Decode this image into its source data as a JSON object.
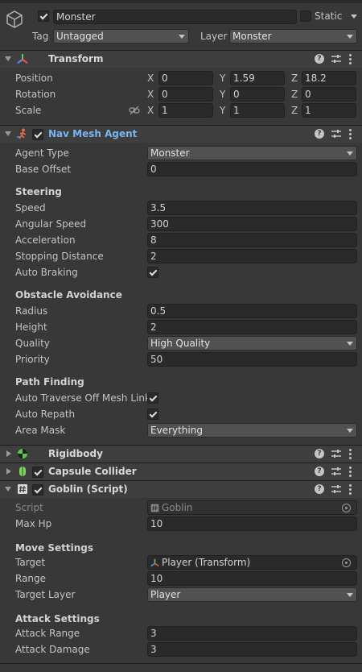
{
  "object": {
    "active": true,
    "name": "Monster",
    "static_label": "Static",
    "static_checked": false,
    "tag_label": "Tag",
    "tag_value": "Untagged",
    "layer_label": "Layer",
    "layer_value": "Monster"
  },
  "transform": {
    "title": "Transform",
    "rows": [
      {
        "label": "Position",
        "x": "0",
        "y": "1.59",
        "z": "18.2"
      },
      {
        "label": "Rotation",
        "x": "0",
        "y": "0",
        "z": "0"
      },
      {
        "label": "Scale",
        "x": "1",
        "y": "1",
        "z": "1"
      }
    ],
    "axis": {
      "x": "X",
      "y": "Y",
      "z": "Z"
    }
  },
  "nav": {
    "title": "Nav Mesh Agent",
    "enabled": true,
    "agent_type_label": "Agent Type",
    "agent_type": "Monster",
    "base_offset_label": "Base Offset",
    "base_offset": "0",
    "steering_label": "Steering",
    "speed_label": "Speed",
    "speed": "3.5",
    "angular_speed_label": "Angular Speed",
    "angular_speed": "300",
    "acceleration_label": "Acceleration",
    "acceleration": "8",
    "stopping_distance_label": "Stopping Distance",
    "stopping_distance": "2",
    "auto_braking_label": "Auto Braking",
    "auto_braking": true,
    "obstacle_label": "Obstacle Avoidance",
    "radius_label": "Radius",
    "radius": "0.5",
    "height_label": "Height",
    "height": "2",
    "quality_label": "Quality",
    "quality": "High Quality",
    "priority_label": "Priority",
    "priority": "50",
    "path_label": "Path Finding",
    "auto_traverse_label": "Auto Traverse Off Mesh Link",
    "auto_traverse": true,
    "auto_repath_label": "Auto Repath",
    "auto_repath": true,
    "area_mask_label": "Area Mask",
    "area_mask": "Everything"
  },
  "rigidbody": {
    "title": "Rigidbody"
  },
  "capsule": {
    "title": "Capsule Collider",
    "enabled": true
  },
  "script": {
    "title": "Goblin (Script)",
    "enabled": true,
    "script_label": "Script",
    "script_value": "Goblin",
    "max_hp_label": "Max Hp",
    "max_hp": "10",
    "move_label": "Move Settings",
    "target_label": "Target",
    "target_value": "Player (Transform)",
    "range_label": "Range",
    "range": "10",
    "target_layer_label": "Target Layer",
    "target_layer": "Player",
    "attack_label": "Attack Settings",
    "attack_range_label": "Attack Range",
    "attack_range": "3",
    "attack_damage_label": "Attack Damage",
    "attack_damage": "3"
  },
  "header_icons": {
    "help": "?"
  },
  "colors": {
    "bg": "#383838",
    "header": "#3e3e3e",
    "field": "#2a2a2a",
    "nav_title": "#7ab4f0"
  }
}
